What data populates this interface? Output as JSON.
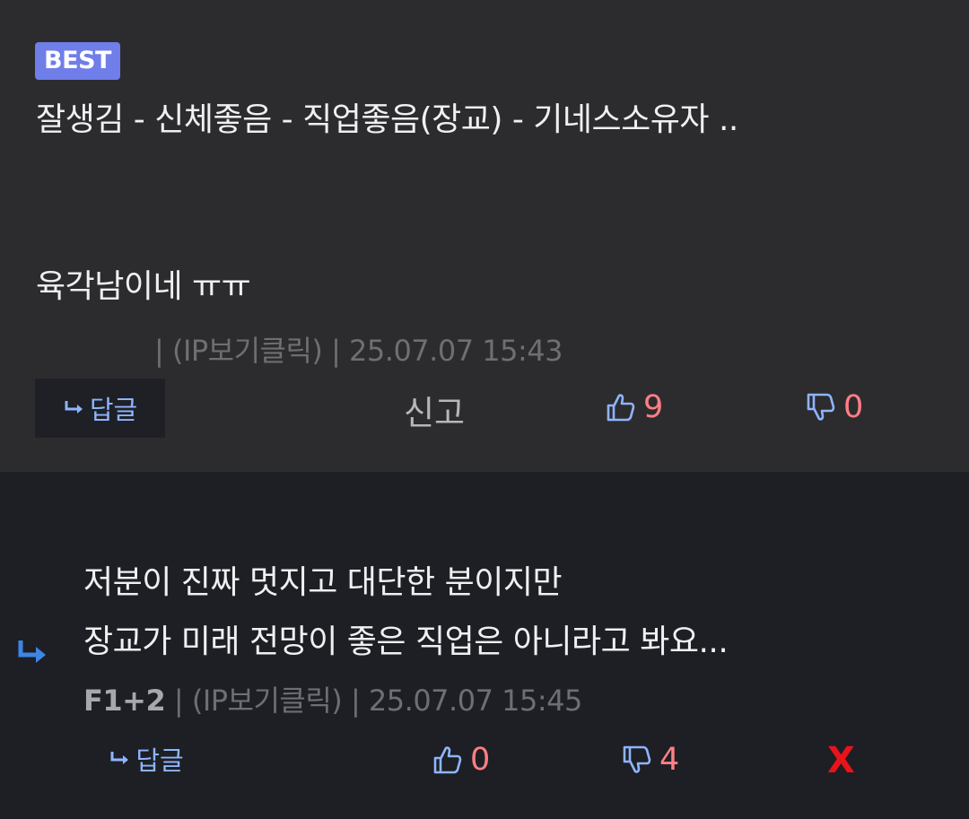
{
  "best_comment": {
    "badge": "BEST",
    "line1": "잘생김 - 신체좋음 - 직업좋음(장교) - 기네스소유자 ..",
    "line2": "육각남이네 ㅠㅠ",
    "ip_label": "(IP보기클릭)",
    "timestamp": "25.07.07 15:43",
    "reply_label": "답글",
    "report_label": "신고",
    "upvotes": "9",
    "downvotes": "0"
  },
  "reply_comment": {
    "line1": "저분이 진짜 멋지고 대단한 분이지만",
    "line2": "장교가 미래 전망이 좋은 직업은 아니라고 봐요...",
    "author": "F1+2",
    "ip_label": "(IP보기클릭)",
    "timestamp": "25.07.07 15:45",
    "reply_label": "답글",
    "upvotes": "0",
    "downvotes": "4",
    "delete_label": "X"
  },
  "colors": {
    "badge": "#6f7ee8",
    "vote_count": "#ff7f86",
    "link": "#8fb4ff",
    "delete": "#e8131b"
  }
}
